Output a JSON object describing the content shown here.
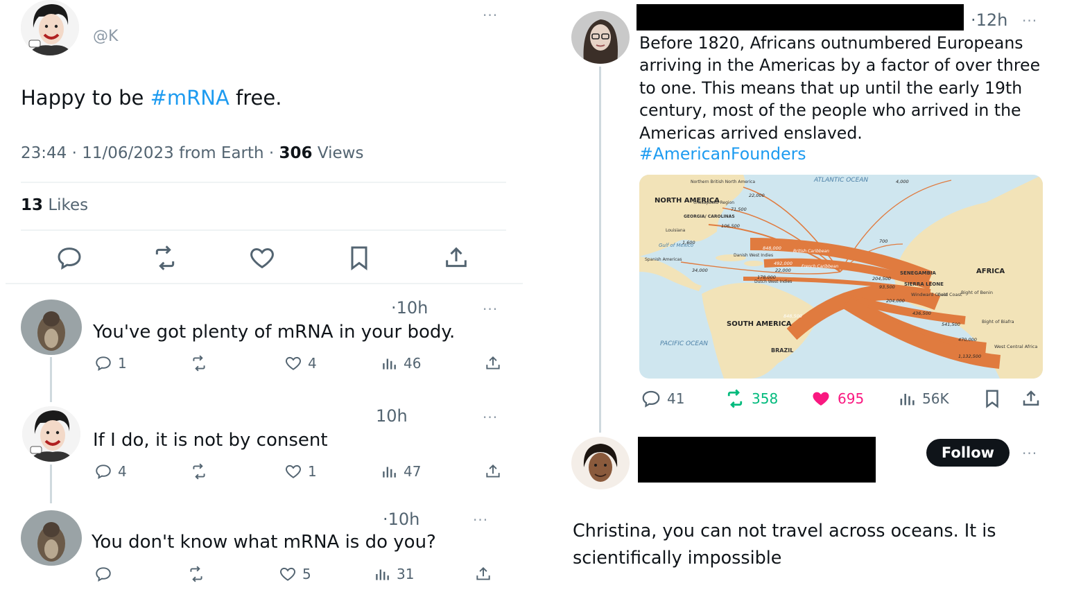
{
  "left": {
    "main_tweet": {
      "handle": "@K",
      "text_before": "Happy to be ",
      "hashtag": "#mRNA",
      "text_after": " free.",
      "meta_prefix": "23:44 · 11/06/2023 from Earth · ",
      "views_count": "306",
      "views_label": " Views",
      "likes_count": "13",
      "likes_label": " Likes",
      "more": "···"
    },
    "replies": [
      {
        "time": "·10h",
        "text": "You've got plenty of mRNA in your body.",
        "replies": "1",
        "likes": "4",
        "views": "46",
        "more": "···"
      },
      {
        "time": "10h",
        "text": "If I do, it is not by consent",
        "replies": "4",
        "likes": "1",
        "views": "47",
        "more": "···"
      },
      {
        "time": "·10h",
        "text": "You don't know what mRNA is do you?",
        "replies": "",
        "likes": "5",
        "views": "31",
        "more": "···"
      }
    ]
  },
  "right": {
    "tweet": {
      "time": "·12h",
      "more": "···",
      "text": "Before 1820, Africans outnumbered Europeans arriving in the Americas by a factor of over three to one. This means that up until the early 19th century, most of the people who arrived in the Americas arrived enslaved.",
      "hashtag": "#AmericanFounders",
      "replies": "41",
      "retweets": "358",
      "likes": "695",
      "views": "56K"
    },
    "map": {
      "labels": {
        "north_america": "NORTH AMERICA",
        "south_america": "SOUTH AMERICA",
        "africa": "AFRICA",
        "atlantic": "ATLANTIC OCEAN",
        "pacific": "PACIFIC OCEAN",
        "brazil": "BRAZIL",
        "gulf": "Gulf of Mexico",
        "senegambia": "SENEGAMBIA",
        "sierra_leone": "SIERRA LEONE",
        "windward": "Windward Coast",
        "gold": "Gold Coast",
        "benin": "Bight of Benin",
        "biafra": "Bight of Biafra",
        "west_central": "West Central Africa",
        "n_british": "Northern British North America",
        "chesapeake": "Chesapeake Region",
        "carolinas": "GEORGIA/ CAROLINAS",
        "louisiana": "Louisiana",
        "spanish": "Spanish Americas",
        "danish": "Danish West Indies",
        "british_carib": "British Caribbean",
        "french_carib": "French Caribbean",
        "dutch": "Dutch West Indies"
      },
      "numbers": {
        "n1": "22,000",
        "n2": "71,500",
        "n3": "106,500",
        "n4": "1,600",
        "n5": "34,000",
        "n6": "848,000",
        "n7": "492,000",
        "n8": "22,000",
        "n9": "178,000",
        "n10": "4,000",
        "n11": "700",
        "n12": "204,500",
        "n13": "93,500",
        "n14": "204,000",
        "n15": "436,500",
        "n16": "541,500",
        "n17": "470,000",
        "n18": "1,132,500",
        "n19": "848,500"
      }
    },
    "reply": {
      "follow": "Follow",
      "more": "···",
      "text": "Christina, you can not travel across oceans. It is scientifically impossible"
    }
  },
  "colors": {
    "accent": "#1d9bf0",
    "retweet_green": "#00ba7c",
    "like_pink": "#f91880",
    "map_arrow": "#e07b3f",
    "map_land": "#f2e3b8",
    "map_sea": "#cfe6ef"
  }
}
